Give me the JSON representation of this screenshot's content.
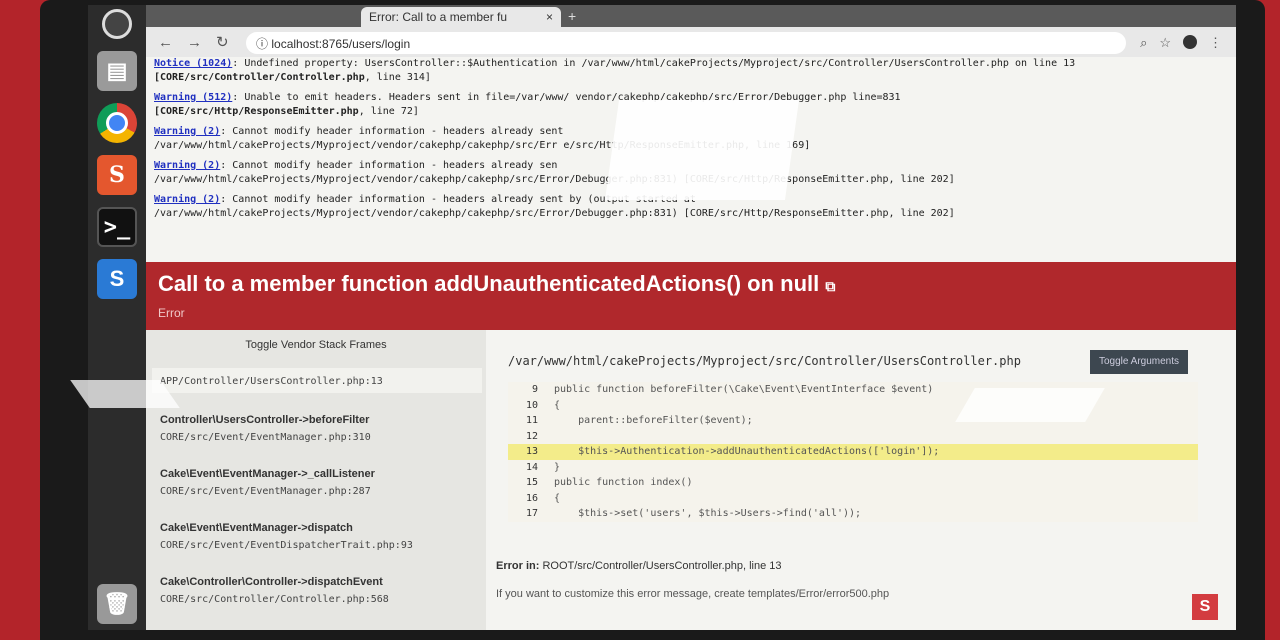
{
  "browser": {
    "tab_title": "Error: Call to a member fu",
    "tab_close": "×",
    "url": "localhost:8765/users/login"
  },
  "notices": [
    {
      "level": "Notice (1024)",
      "message": ": Undefined property: UsersController::$Authentication in /var/www/html/cakeProjects/Myproject/src/Controller/UsersController.php on line 13",
      "file": "[CORE/src/Controller/Controller.php",
      "line": ", line 314]"
    },
    {
      "level": "Warning (512)",
      "message": ": Unable to emit headers. Headers sent in file=/var/www/",
      "message2": "vendor/cakephp/cakephp/src/Error/Debugger.php line=831",
      "file": "[CORE/src/Http/ResponseEmitter.php",
      "line": ", line 72]"
    },
    {
      "level": "Warning (2)",
      "message": ": Cannot modify header information - headers already sent",
      "path": "/var/www/html/cakeProjects/Myproject/vendor/cakephp/cakephp/src/Err",
      "tail": "e/src/Http/ResponseEmitter.php, line 169]"
    },
    {
      "level": "Warning (2)",
      "message": ": Cannot modify header information - headers already sen",
      "path": "/var/www/html/cakeProjects/Myproject/vendor/cakephp/cakephp/src/Error/Debugger.php:831) [CORE/src/Http/ResponseEmitter.php, line 202]"
    },
    {
      "level": "Warning (2)",
      "message": ": Cannot modify header information - headers already sent by (output started at",
      "path": "/var/www/html/cakeProjects/Myproject/vendor/cakephp/cakephp/src/Error/Debugger.php:831) [CORE/src/Http/ResponseEmitter.php, line 202]"
    }
  ],
  "error": {
    "title": "Call to a member function addUnauthenticatedActions() on null",
    "type": "Error"
  },
  "stack": {
    "toggle_vendor": "Toggle Vendor Stack Frames",
    "frames": [
      {
        "fn": "",
        "path": "APP/Controller/UsersController.php:13"
      },
      {
        "fn": "Controller\\UsersController->beforeFilter",
        "path": "CORE/src/Event/EventManager.php:310"
      },
      {
        "fn": "Cake\\Event\\EventManager->_callListener",
        "path": "CORE/src/Event/EventManager.php:287"
      },
      {
        "fn": "Cake\\Event\\EventManager->dispatch",
        "path": "CORE/src/Event/EventDispatcherTrait.php:93"
      },
      {
        "fn": "Cake\\Controller\\Controller->dispatchEvent",
        "path": "CORE/src/Controller/Controller.php:568"
      }
    ]
  },
  "source": {
    "file": "/var/www/html/cakeProjects/Myproject/src/Controller/UsersController.php",
    "toggle_args": "Toggle Arguments",
    "lines": [
      {
        "n": "9",
        "t": "public function beforeFilter(\\Cake\\Event\\EventInterface $event)"
      },
      {
        "n": "10",
        "t": "{"
      },
      {
        "n": "11",
        "t": "    parent::beforeFilter($event);"
      },
      {
        "n": "12",
        "t": ""
      },
      {
        "n": "13",
        "t": "    $this->Authentication->addUnauthenticatedActions(['login']);"
      },
      {
        "n": "14",
        "t": "}"
      },
      {
        "n": "15",
        "t": "public function index()"
      },
      {
        "n": "16",
        "t": "{"
      },
      {
        "n": "17",
        "t": "    $this->set('users', $this->Users->find('all'));"
      }
    ],
    "highlight_line": "13",
    "error_in_label": "Error in:",
    "error_in_value": "ROOT/src/Controller/UsersController.php, line 13",
    "customize": "If you want to customize this error message, create templates/Error/error500.php"
  },
  "colors": {
    "error_red": "#b0282c",
    "highlight": "#f3ec8a"
  }
}
